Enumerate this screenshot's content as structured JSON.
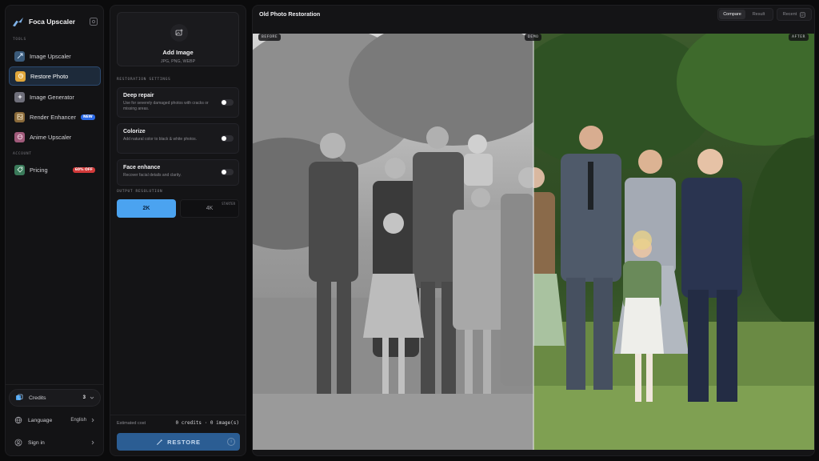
{
  "brand": {
    "name": "Foca Upscaler"
  },
  "sidebar": {
    "tools_label": "TOOLS",
    "account_label": "ACCOUNT",
    "items": [
      {
        "label": "Image Upscaler",
        "icon": "upscale-icon"
      },
      {
        "label": "Restore Photo",
        "icon": "restore-icon"
      },
      {
        "label": "Image Generator",
        "icon": "generator-icon"
      },
      {
        "label": "Render Enhancer",
        "icon": "render-icon",
        "badge": "NEW"
      },
      {
        "label": "Anime Upscaler",
        "icon": "anime-icon"
      }
    ],
    "pricing": {
      "label": "Pricing",
      "badge": "60% OFF"
    },
    "footer": {
      "credits_label": "Credits",
      "credits_value": "3",
      "language_label": "Language",
      "language_value": "English",
      "signin_label": "Sign in"
    }
  },
  "panel": {
    "add_image": {
      "title": "Add Image",
      "formats": "JPG, PNG, WEBP"
    },
    "settings_label": "RESTORATION SETTINGS",
    "options": [
      {
        "title": "Deep repair",
        "desc": "Use for severely damaged photos with cracks or missing areas.",
        "enabled": false
      },
      {
        "title": "Colorize",
        "desc": "Add natural color to black & white photos.",
        "enabled": false
      },
      {
        "title": "Face enhance",
        "desc": "Recover facial details and clarity.",
        "enabled": false
      }
    ],
    "resolution_label": "OUTPUT RESOLUTION",
    "resolution": {
      "option_2k": "2K",
      "option_4k": "4K",
      "starter_tag": "STARTER",
      "selected": "2K"
    },
    "cost": {
      "label": "Estimated cost",
      "value": "0 credits · 0 image(s)"
    },
    "restore_label": "RESTORE",
    "info_glyph": "i"
  },
  "main": {
    "title": "Old Photo Restoration",
    "view_modes": [
      "Compare",
      "Result"
    ],
    "active_view": "Compare",
    "recent_label": "Recent",
    "tags": {
      "before": "BEFORE",
      "demo": "DEMO",
      "after": "AFTER"
    },
    "split_fraction": 0.5
  },
  "colors": {
    "accent": "#4ba3f0",
    "restore_button": "#2b5d93",
    "badge_new": "#2b6ae8",
    "badge_off": "#d23a3a"
  }
}
